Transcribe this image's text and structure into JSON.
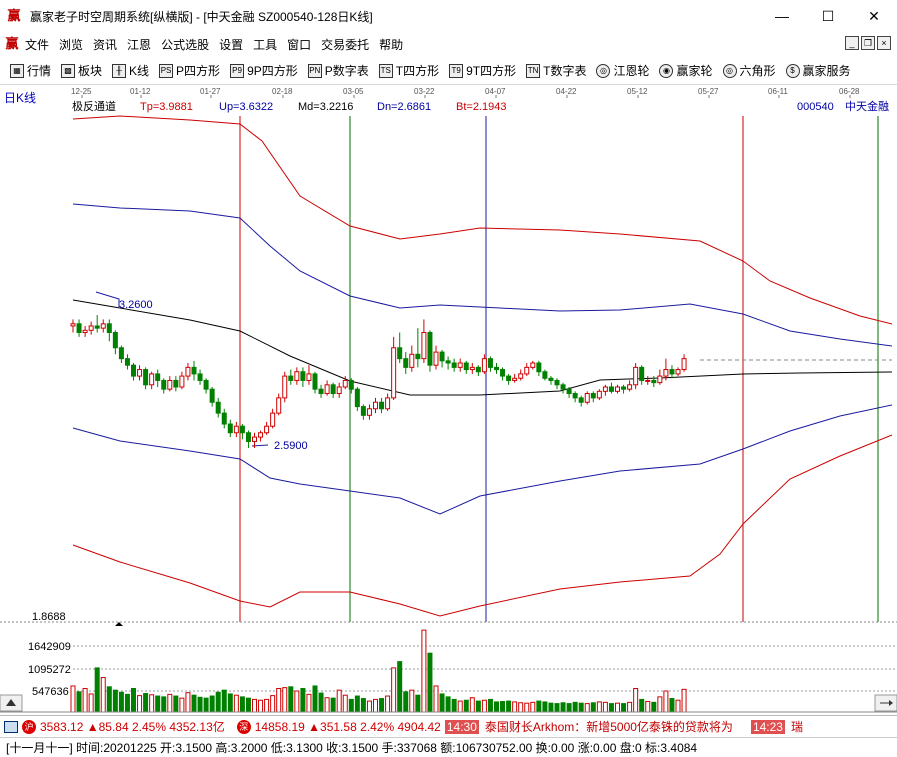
{
  "window": {
    "title": "赢家老子时空周期系统[纵横版] - [中天金融  SZ000540-128日K线]",
    "app_icon": "赢",
    "controls": [
      "—",
      "☐",
      "✕"
    ]
  },
  "menu": {
    "icon": "赢",
    "items": [
      "文件",
      "浏览",
      "资讯",
      "江恩",
      "公式选股",
      "设置",
      "工具",
      "窗口",
      "交易委托",
      "帮助"
    ]
  },
  "toolbar": {
    "items": [
      {
        "label": "行情",
        "icon": "grid-icon",
        "glyph": "▦"
      },
      {
        "label": "板块",
        "icon": "blocks-icon",
        "glyph": "▩"
      },
      {
        "label": "K线",
        "icon": "candle-icon",
        "glyph": "╫"
      },
      {
        "label": "P四方形",
        "icon": "ps-icon",
        "glyph": "PS"
      },
      {
        "label": "9P四方形",
        "icon": "p9-icon",
        "glyph": "P9"
      },
      {
        "label": "P数字表",
        "icon": "pn-icon",
        "glyph": "PN"
      },
      {
        "label": "T四方形",
        "icon": "ts-icon",
        "glyph": "TS"
      },
      {
        "label": "9T四方形",
        "icon": "t9-icon",
        "glyph": "T9"
      },
      {
        "label": "T数字表",
        "icon": "tn-icon",
        "glyph": "TN"
      },
      {
        "label": "江恩轮",
        "icon": "gann-wheel-icon",
        "glyph": "◎"
      },
      {
        "label": "赢家轮",
        "icon": "winner-wheel-icon",
        "glyph": "◉"
      },
      {
        "label": "六角形",
        "icon": "hexagon-icon",
        "glyph": "◎"
      },
      {
        "label": "赢家服务",
        "icon": "dollar-icon",
        "glyph": "$"
      }
    ]
  },
  "chart_header": {
    "period": "日K线",
    "indicator": "极反通道",
    "tp": "Tp=3.9881",
    "up": "Up=3.6322",
    "md": "Md=3.2216",
    "dn": "Dn=2.6861",
    "bt": "Bt=2.1943",
    "code": "000540",
    "name": "中天金融"
  },
  "chart_data": {
    "type": "candlestick",
    "date_ticks": [
      "12-25",
      "01-12",
      "01-27",
      "02-18",
      "03-05",
      "03-22",
      "04-07",
      "04-22",
      "05-12",
      "05-27",
      "06-11",
      "06-28"
    ],
    "annotations": {
      "high_label": "3.2600",
      "low_label": "2.5900"
    },
    "price_axis_min_label": "1.8688",
    "volume_axis_labels": [
      "1642909",
      "1095272",
      "547636"
    ],
    "colors": {
      "up": "#d00000",
      "down": "#008000",
      "outer_band": "#cc0000",
      "inner_band": "#1a1aa0",
      "middle": "#000000",
      "vline_red": "#cc0000",
      "vline_green": "#007000",
      "vline_blue": "#1a1aa0"
    },
    "candles": [
      [
        3.15,
        3.16,
        3.12,
        3.18
      ],
      [
        3.16,
        3.12,
        3.1,
        3.18
      ],
      [
        3.12,
        3.13,
        3.1,
        3.15
      ],
      [
        3.13,
        3.15,
        3.11,
        3.17
      ],
      [
        3.15,
        3.14,
        3.12,
        3.2
      ],
      [
        3.14,
        3.16,
        3.12,
        3.18
      ],
      [
        3.16,
        3.12,
        3.08,
        3.18
      ],
      [
        3.12,
        3.05,
        3.02,
        3.13
      ],
      [
        3.05,
        3.0,
        2.98,
        3.06
      ],
      [
        3.0,
        2.97,
        2.95,
        3.02
      ],
      [
        2.97,
        2.92,
        2.9,
        2.98
      ],
      [
        2.92,
        2.95,
        2.9,
        2.97
      ],
      [
        2.95,
        2.88,
        2.86,
        2.96
      ],
      [
        2.88,
        2.93,
        2.86,
        2.94
      ],
      [
        2.93,
        2.9,
        2.87,
        2.95
      ],
      [
        2.9,
        2.86,
        2.84,
        2.91
      ],
      [
        2.86,
        2.9,
        2.85,
        2.92
      ],
      [
        2.9,
        2.87,
        2.85,
        2.92
      ],
      [
        2.87,
        2.92,
        2.86,
        2.94
      ],
      [
        2.92,
        2.96,
        2.9,
        2.98
      ],
      [
        2.96,
        2.93,
        2.9,
        2.99
      ],
      [
        2.93,
        2.9,
        2.88,
        2.95
      ],
      [
        2.9,
        2.86,
        2.84,
        2.91
      ],
      [
        2.86,
        2.8,
        2.78,
        2.87
      ],
      [
        2.8,
        2.75,
        2.73,
        2.82
      ],
      [
        2.75,
        2.7,
        2.68,
        2.77
      ],
      [
        2.7,
        2.66,
        2.64,
        2.72
      ],
      [
        2.66,
        2.69,
        2.64,
        2.71
      ],
      [
        2.69,
        2.66,
        2.63,
        2.7
      ],
      [
        2.66,
        2.62,
        2.59,
        2.67
      ],
      [
        2.62,
        2.64,
        2.59,
        2.66
      ],
      [
        2.64,
        2.66,
        2.62,
        2.67
      ],
      [
        2.66,
        2.69,
        2.65,
        2.71
      ],
      [
        2.69,
        2.75,
        2.68,
        2.77
      ],
      [
        2.75,
        2.82,
        2.74,
        2.84
      ],
      [
        2.82,
        2.92,
        2.8,
        2.94
      ],
      [
        2.92,
        2.9,
        2.88,
        2.95
      ],
      [
        2.9,
        2.94,
        2.88,
        2.96
      ],
      [
        2.94,
        2.9,
        2.87,
        2.96
      ],
      [
        2.9,
        2.93,
        2.88,
        2.97
      ],
      [
        2.93,
        2.86,
        2.84,
        2.94
      ],
      [
        2.86,
        2.84,
        2.82,
        2.88
      ],
      [
        2.84,
        2.88,
        2.83,
        2.9
      ],
      [
        2.88,
        2.84,
        2.82,
        2.89
      ],
      [
        2.84,
        2.87,
        2.82,
        2.89
      ],
      [
        2.87,
        2.9,
        2.86,
        2.92
      ],
      [
        2.9,
        2.86,
        2.84,
        2.91
      ],
      [
        2.86,
        2.78,
        2.76,
        2.87
      ],
      [
        2.78,
        2.74,
        2.72,
        2.79
      ],
      [
        2.74,
        2.77,
        2.72,
        2.79
      ],
      [
        2.77,
        2.8,
        2.75,
        2.82
      ],
      [
        2.8,
        2.77,
        2.75,
        2.82
      ],
      [
        2.77,
        2.82,
        2.76,
        2.84
      ],
      [
        2.82,
        3.05,
        2.81,
        3.1
      ],
      [
        3.05,
        3.0,
        2.98,
        3.12
      ],
      [
        3.0,
        2.96,
        2.93,
        3.03
      ],
      [
        2.96,
        3.02,
        2.94,
        3.06
      ],
      [
        3.02,
        3.0,
        2.96,
        3.14
      ],
      [
        3.0,
        3.12,
        2.98,
        3.18
      ],
      [
        3.12,
        2.97,
        2.94,
        3.13
      ],
      [
        2.97,
        3.03,
        2.95,
        3.06
      ],
      [
        3.03,
        2.99,
        2.96,
        3.04
      ],
      [
        2.99,
        2.98,
        2.95,
        3.01
      ],
      [
        2.98,
        2.96,
        2.94,
        3.0
      ],
      [
        2.96,
        2.98,
        2.94,
        3.0
      ],
      [
        2.98,
        2.95,
        2.93,
        2.99
      ],
      [
        2.95,
        2.96,
        2.93,
        2.98
      ],
      [
        2.96,
        2.94,
        2.92,
        2.97
      ],
      [
        2.94,
        3.0,
        2.93,
        3.02
      ],
      [
        3.0,
        2.96,
        2.94,
        3.01
      ],
      [
        2.96,
        2.95,
        2.93,
        2.98
      ],
      [
        2.95,
        2.92,
        2.9,
        2.96
      ],
      [
        2.92,
        2.9,
        2.88,
        2.93
      ],
      [
        2.9,
        2.91,
        2.89,
        2.93
      ],
      [
        2.91,
        2.93,
        2.9,
        2.95
      ],
      [
        2.93,
        2.96,
        2.92,
        2.98
      ],
      [
        2.96,
        2.98,
        2.95,
        2.99
      ],
      [
        2.98,
        2.94,
        2.92,
        2.99
      ],
      [
        2.94,
        2.91,
        2.9,
        2.95
      ],
      [
        2.91,
        2.9,
        2.88,
        2.92
      ],
      [
        2.9,
        2.88,
        2.86,
        2.91
      ],
      [
        2.88,
        2.86,
        2.84,
        2.89
      ],
      [
        2.86,
        2.84,
        2.82,
        2.87
      ],
      [
        2.84,
        2.82,
        2.8,
        2.85
      ],
      [
        2.82,
        2.8,
        2.78,
        2.83
      ],
      [
        2.8,
        2.84,
        2.79,
        2.85
      ],
      [
        2.84,
        2.82,
        2.8,
        2.85
      ],
      [
        2.82,
        2.85,
        2.81,
        2.86
      ],
      [
        2.85,
        2.87,
        2.83,
        2.88
      ],
      [
        2.87,
        2.85,
        2.84,
        2.89
      ],
      [
        2.85,
        2.87,
        2.84,
        2.88
      ],
      [
        2.87,
        2.86,
        2.84,
        2.88
      ],
      [
        2.86,
        2.88,
        2.85,
        2.9
      ],
      [
        2.88,
        2.96,
        2.86,
        2.98
      ],
      [
        2.96,
        2.9,
        2.88,
        2.97
      ],
      [
        2.9,
        2.9,
        2.88,
        2.92
      ],
      [
        2.9,
        2.89,
        2.87,
        2.92
      ],
      [
        2.89,
        2.92,
        2.88,
        2.95
      ],
      [
        2.92,
        2.95,
        2.9,
        3.0
      ],
      [
        2.95,
        2.93,
        2.91,
        2.97
      ],
      [
        2.93,
        2.95,
        2.92,
        2.96
      ],
      [
        2.95,
        3.0,
        2.94,
        3.02
      ]
    ],
    "volumes": [
      620000,
      480000,
      560000,
      430000,
      1050000,
      820000,
      600000,
      520000,
      470000,
      420000,
      560000,
      390000,
      440000,
      410000,
      380000,
      360000,
      420000,
      380000,
      330000,
      460000,
      400000,
      350000,
      330000,
      380000,
      470000,
      520000,
      430000,
      400000,
      360000,
      330000,
      300000,
      280000,
      300000,
      390000,
      560000,
      580000,
      600000,
      500000,
      560000,
      420000,
      620000,
      450000,
      340000,
      330000,
      520000,
      400000,
      300000,
      380000,
      320000,
      260000,
      300000,
      320000,
      380000,
      1050000,
      1200000,
      480000,
      520000,
      400000,
      1950000,
      1400000,
      620000,
      430000,
      360000,
      300000,
      260000,
      280000,
      340000,
      260000,
      280000,
      300000,
      240000,
      250000,
      260000,
      240000,
      220000,
      210000,
      230000,
      260000,
      240000,
      210000,
      200000,
      220000,
      200000,
      230000,
      210000,
      200000,
      220000,
      240000,
      230000,
      200000,
      210000,
      200000,
      230000,
      560000,
      300000,
      250000,
      230000,
      360000,
      500000,
      320000,
      280000,
      540000
    ]
  },
  "status": {
    "idx1_value": "3583.12",
    "idx1_change": "▲85.84",
    "idx1_pct": "2.45%",
    "idx1_amount": "4352.13亿",
    "idx2_value": "14858.19",
    "idx2_change": "▲351.58",
    "idx2_pct": "2.42%",
    "idx2_amount": "4904.42",
    "news_time": "14:30",
    "news_text": "泰国财长Arkhom：新增5000亿泰铢的贷款将为",
    "news_time2": "14:23",
    "news_trail": "瑞"
  },
  "infobar": {
    "text": "[十一月十一] 时间:20201225 开:3.1500 高:3.2000 低:3.1300 收:3.1500 手:337068 额:106730752.00 换:0.00 涨:0.00 盘:0 标:3.4084"
  }
}
